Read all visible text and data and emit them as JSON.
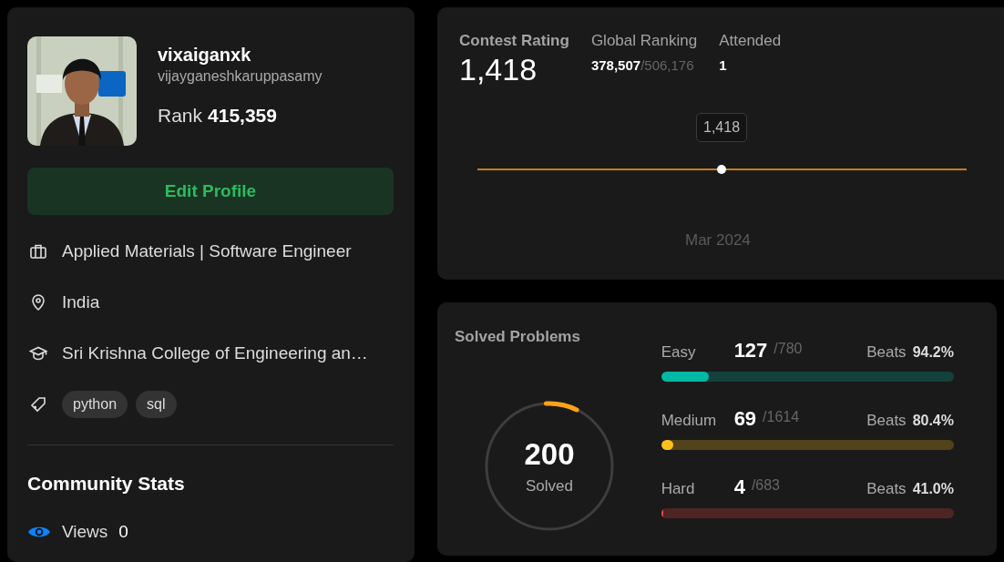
{
  "profile": {
    "username": "vixaiganxk",
    "handle": "vijayganeshkaruppasamy",
    "rank_label": "Rank",
    "rank": "415,359",
    "edit_button": "Edit Profile",
    "info": [
      {
        "kind": "company",
        "text": "Applied Materials | Software Engineer"
      },
      {
        "kind": "location",
        "text": "India"
      },
      {
        "kind": "school",
        "text": "Sri Krishna College of Engineering an…"
      },
      {
        "kind": "skills",
        "tags": [
          "python",
          "sql"
        ]
      }
    ],
    "community_stats": {
      "title": "Community Stats",
      "items": [
        {
          "kind": "views",
          "label": "Views",
          "value": "0"
        }
      ]
    }
  },
  "contest": {
    "label": "Contest Rating",
    "rating": "1,418",
    "stats": [
      {
        "label": "Global Ranking",
        "value": "378,507",
        "total": "/506,176"
      },
      {
        "label": "Attended",
        "value": "1"
      }
    ],
    "chart": {
      "tooltip": "1,418",
      "x_label": "Mar 2024"
    }
  },
  "solved": {
    "title": "Solved Problems",
    "total": "200",
    "total_label": "Solved",
    "difficulties": [
      {
        "name": "Easy",
        "solved": "127",
        "total": "/780",
        "beats_label": "Beats",
        "beats": "94.2%",
        "level": 0.163,
        "color": "#00b8a3"
      },
      {
        "name": "Medium",
        "solved": "69",
        "total": "/1614",
        "beats_label": "Beats",
        "beats": "80.4%",
        "level": 0.043,
        "color": "#ffc01e"
      },
      {
        "name": "Hard",
        "solved": "4",
        "total": "/683",
        "beats_label": "Beats",
        "beats": "41.0%",
        "level": 0.006,
        "color": "#ef4743"
      }
    ]
  }
}
